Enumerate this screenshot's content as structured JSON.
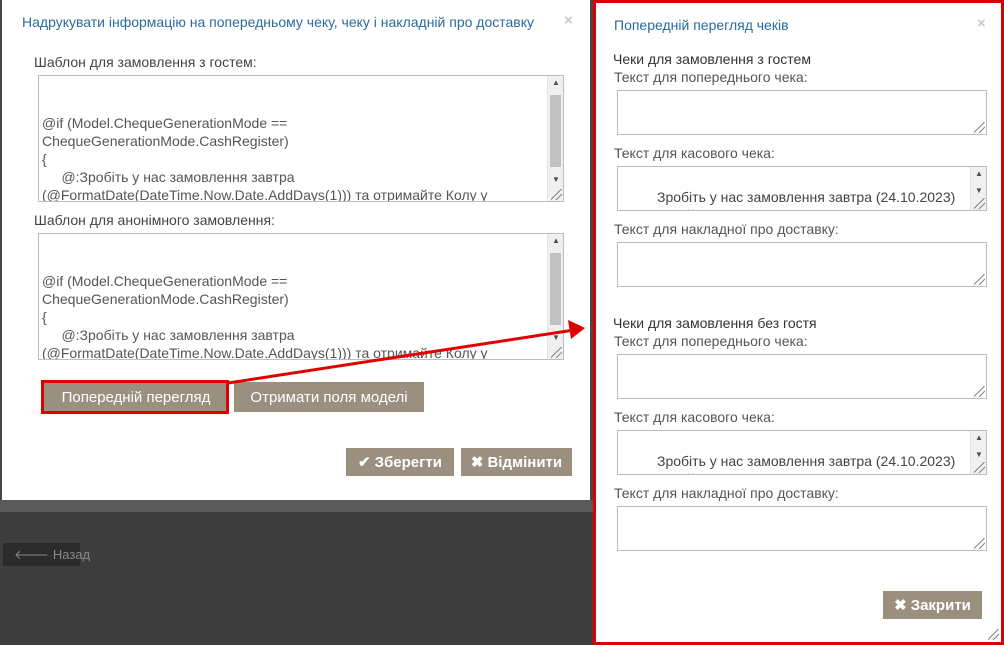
{
  "background": {
    "back_button_label": "Назад"
  },
  "left_dialog": {
    "title": "Надрукувати інформацію на попередньому чеку, чеку і накладній про доставку",
    "close_glyph": "×",
    "guest_template_label": "Шаблон для замовлення з гостем:",
    "guest_template_value": "@if (Model.ChequeGenerationMode ==\nChequeGenerationMode.CashRegister)\n{\n     @:Зробіть у нас замовлення завтра\n(@FormatDate(DateTime.Now.Date.AddDays(1))) та отримайте Колу у\nподарунок!\n}",
    "anon_template_label": "Шаблон для анонімного замовлення:",
    "anon_template_value": "@if (Model.ChequeGenerationMode ==\nChequeGenerationMode.CashRegister)\n{\n     @:Зробіть у нас замовлення завтра\n(@FormatDate(DateTime.Now.Date.AddDays(1))) та отримайте Колу у\nподарунок!\n}",
    "preview_button": "Попередній перегляд",
    "get_fields_button": "Отримати поля моделі",
    "save_button": "Зберегти",
    "cancel_button": "Відмінити"
  },
  "right_dialog": {
    "title": "Попередній перегляд чеків",
    "close_glyph": "×",
    "guest_section": {
      "heading": "Чеки для замовлення з гостем",
      "precheck_label": "Текст для попереднього чека:",
      "precheck_value": "",
      "cash_label": "Текст для касового чека:",
      "cash_value": "     Зробіть у нас замовлення завтра (24.10.2023)\nта отримайте Колу у подарунок!",
      "delivery_label": "Текст для накладної про доставку:",
      "delivery_value": ""
    },
    "anon_section": {
      "heading": "Чеки для замовлення без гостя",
      "precheck_label": "Текст для попереднього чека:",
      "precheck_value": "",
      "cash_label": "Текст для касового чека:",
      "cash_value": "     Зробіть у нас замовлення завтра (24.10.2023)\nта отримайте Колу у подарунок!",
      "delivery_label": "Текст для накладної про доставку:",
      "delivery_value": ""
    },
    "close_button": "Закрити"
  },
  "colors": {
    "accent_title": "#2a6a9e",
    "button_bg": "#9b9080",
    "highlight": "#e00000"
  },
  "icons": {
    "save": "check-icon",
    "cancel": "x-icon",
    "back": "arrow-left-icon"
  }
}
